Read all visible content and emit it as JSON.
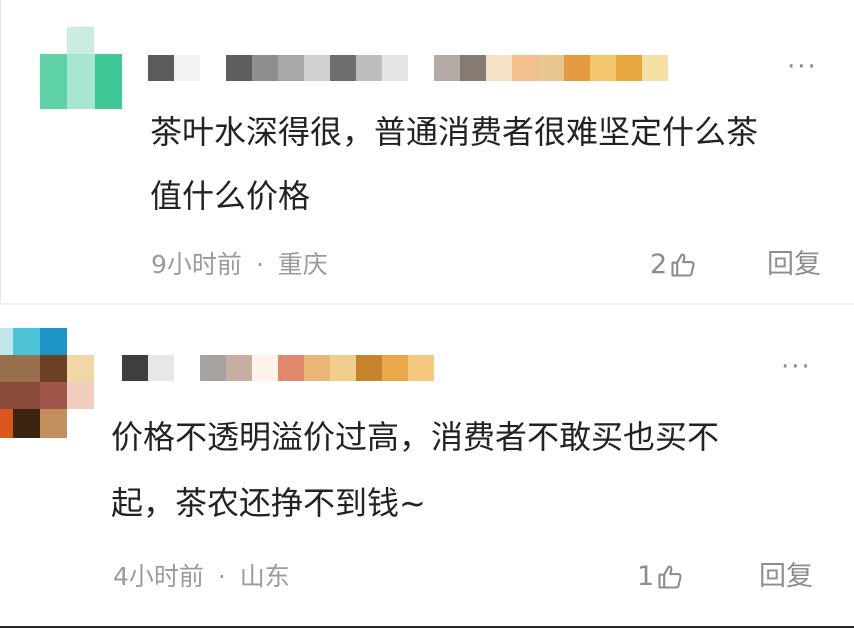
{
  "comments": [
    {
      "text_line1": "茶叶水深得很，普通消费者很难坚定什么茶",
      "text_line2": "值什么价格",
      "time": "9小时前",
      "separator": "·",
      "location": "重庆",
      "likes": "2",
      "reply_label": "回复",
      "more_label": "···",
      "avatar_colors": [
        "#c9ede0",
        "#5fd3a5",
        "#a8e6cf",
        "#3fc795"
      ],
      "name_colors": [
        "#5b5b5b",
        "#f2f2f2",
        "#ffffff",
        "#5e5e5e",
        "#8e8e8e",
        "#a9a9a9",
        "#d0d0d0",
        "#6e6e6e",
        "#bdbdbd",
        "#e4e4e4",
        "#ffffff",
        "#b3aca4",
        "#857b72",
        "#f7e2c6",
        "#f2c08b",
        "#e9c690",
        "#e69a3f",
        "#f3c56d",
        "#e8a73f",
        "#f6dfa5"
      ]
    },
    {
      "text_line1": "价格不透明溢价过高，消费者不敢买也买不",
      "text_line2": "起，茶农还挣不到钱~",
      "time": "4小时前",
      "separator": "·",
      "location": "山东",
      "likes": "1",
      "reply_label": "回复",
      "more_label": "···",
      "avatar_colors": [
        "#bfe7ec",
        "#4ec3d3",
        "#1e93c6",
        "#9a6f4e",
        "#6b4024",
        "#f1d6a8",
        "#8c4a3c",
        "#a0554a",
        "#f0cdbf",
        "#d9571f",
        "#3d2410",
        "#c28f5f"
      ],
      "name_colors": [
        "#3e3e3e",
        "#e7e7e7",
        "#ffffff",
        "#a5a29f",
        "#c6aea0",
        "#fdf3e8",
        "#e0896a",
        "#e9b677",
        "#f0cf8e",
        "#c8832e",
        "#e9a84a",
        "#f2c97f"
      ]
    }
  ]
}
